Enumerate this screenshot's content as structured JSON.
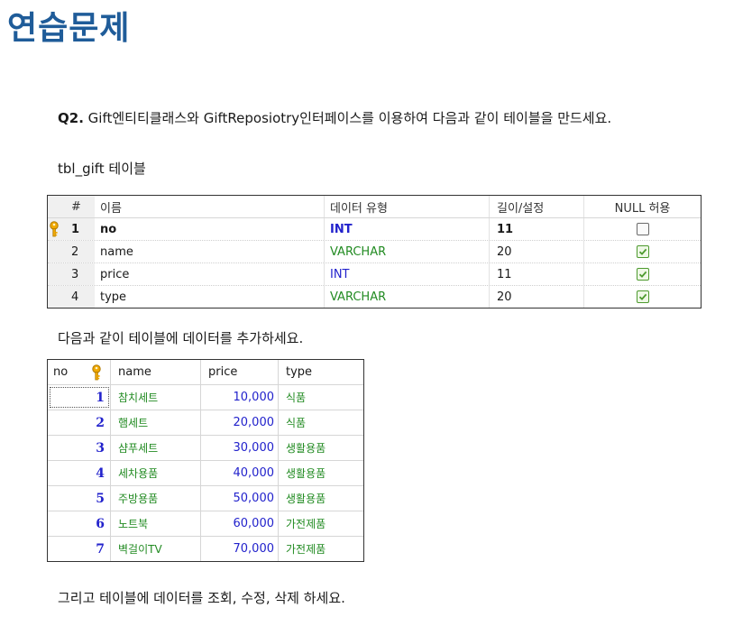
{
  "title": "연습문제",
  "question": {
    "label": "Q2.",
    "text": " Gift엔티티클래스와 GiftReposiotry인터페이스를 이용하여 다음과 같이 테이블을 만드세요."
  },
  "schema_caption": "tbl_gift 테이블",
  "schema_table": {
    "headers": {
      "num": "#",
      "name": "이름",
      "type": "데이터 유형",
      "length": "길이/설정",
      "null": "NULL 허용"
    },
    "rows": [
      {
        "num": "1",
        "name": "no",
        "type": "INT",
        "length": "11",
        "nullable": false,
        "primary_key": true
      },
      {
        "num": "2",
        "name": "name",
        "type": "VARCHAR",
        "length": "20",
        "nullable": true,
        "primary_key": false
      },
      {
        "num": "3",
        "name": "price",
        "type": "INT",
        "length": "11",
        "nullable": true,
        "primary_key": false
      },
      {
        "num": "4",
        "name": "type",
        "type": "VARCHAR",
        "length": "20",
        "nullable": true,
        "primary_key": false
      }
    ]
  },
  "data_caption": "다음과 같이 테이블에 데이터를 추가하세요.",
  "data_table": {
    "headers": {
      "no": "no",
      "name": "name",
      "price": "price",
      "type": "type"
    },
    "rows": [
      {
        "no": "1",
        "name": "참치세트",
        "price": "10,000",
        "type": "식품"
      },
      {
        "no": "2",
        "name": "햄세트",
        "price": "20,000",
        "type": "식품"
      },
      {
        "no": "3",
        "name": "샴푸세트",
        "price": "30,000",
        "type": "생활용품"
      },
      {
        "no": "4",
        "name": "세차용품",
        "price": "40,000",
        "type": "생활용품"
      },
      {
        "no": "5",
        "name": "주방용품",
        "price": "50,000",
        "type": "생활용품"
      },
      {
        "no": "6",
        "name": "노트북",
        "price": "60,000",
        "type": "가전제품"
      },
      {
        "no": "7",
        "name": "벽걸이TV",
        "price": "70,000",
        "type": "가전제품"
      }
    ]
  },
  "footer_text": "그리고 테이블에 데이터를 조회, 수정, 삭제 하세요.",
  "colors": {
    "title": "#1f5c99",
    "int": "#2222cc",
    "varchar": "#228b22",
    "key": "#f0a800",
    "check": "#4d9a2e"
  },
  "icons": {
    "primary_key": "key-icon",
    "checked": "checkbox-checked-icon",
    "unchecked": "checkbox-unchecked-icon"
  }
}
